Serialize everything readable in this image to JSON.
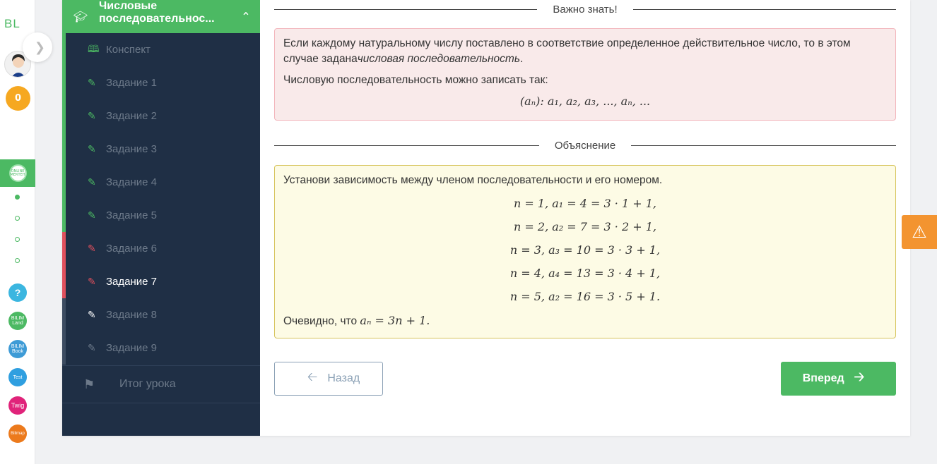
{
  "rail": {
    "logo": "BL",
    "coins": "0",
    "active_app": "ONLINE МЕКТЕП",
    "apps": [
      {
        "name": "help",
        "label": "?",
        "color": "#3bb6e0"
      },
      {
        "name": "bilimland",
        "label": "BILIM Land",
        "color": "#4cb963"
      },
      {
        "name": "bilimbook",
        "label": "BILIM Book",
        "color": "#3e9bd6"
      },
      {
        "name": "test",
        "label": "Test",
        "color": "#2f9fe0"
      },
      {
        "name": "twig",
        "label": "Twig",
        "color": "#e0237a"
      },
      {
        "name": "bilimap",
        "label": "Bilimap",
        "color": "#ec7a1c"
      }
    ]
  },
  "nav": {
    "header_title": "Числовые последовательнос...",
    "items": [
      {
        "label": "Конспект",
        "status": "read"
      },
      {
        "label": "Задание 1",
        "status": "done"
      },
      {
        "label": "Задание 2",
        "status": "done"
      },
      {
        "label": "Задание 3",
        "status": "done"
      },
      {
        "label": "Задание 4",
        "status": "done"
      },
      {
        "label": "Задание 5",
        "status": "done"
      },
      {
        "label": "Задание 6",
        "status": "wrong"
      },
      {
        "label": "Задание 7",
        "status": "current-wrong"
      },
      {
        "label": "Задание 8",
        "status": "open"
      },
      {
        "label": "Задание 9",
        "status": "locked"
      }
    ],
    "summary": "Итог урока"
  },
  "content": {
    "important_title": "Важно знать!",
    "important_text_1": "Если каждому натуральному числу поставлено в соответствие определенное действительное число, то в этом случае задана",
    "important_text_em": "числовая последовательность",
    "important_text_end": ".",
    "important_text_2": "Числовую последовательность можно записать так:",
    "important_formula": "(aₙ): a₁, a₂, a₃, ..., aₙ, ...",
    "explanation_title": "Объяснение",
    "explanation_intro": "Установи зависимость между членом последовательности и его номером.",
    "explanation_lines": [
      "n = 1, a₁ = 4 = 3 · 1 + 1,",
      "n = 2, a₂ = 7 = 3 · 2 + 1,",
      "n = 3, a₃ = 10 = 3 · 3 + 1,",
      "n = 4, a₄ = 13 = 3 · 4 + 1,",
      "n = 5, a₂ = 16 = 3 · 5 + 1."
    ],
    "conclusion_prefix": "Очевидно, что",
    "conclusion_formula": "aₙ = 3n + 1."
  },
  "buttons": {
    "back": "Назад",
    "next": "Вперед"
  },
  "colors": {
    "accent_green": "#4cb963",
    "error_red": "#e0505d",
    "nav_bg": "#1f2f45",
    "warning_orange": "#f39430"
  }
}
